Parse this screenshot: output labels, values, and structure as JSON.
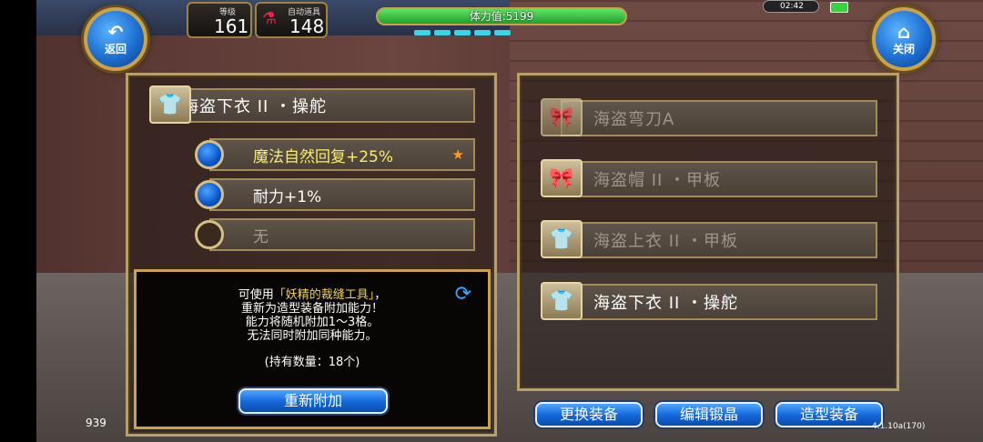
{
  "hud": {
    "back_label": "返回",
    "close_label": "关闭",
    "level_caption": "等级",
    "level_value": "161",
    "potion_caption": "自动道具",
    "potion_value": "148",
    "hp_text": "体力值:5199",
    "clock": "02:42",
    "partial_left_number": "939",
    "version": "4.1.10a(170)"
  },
  "left_panel": {
    "selected_item": "海盗下衣 II ・操舵",
    "abilities": [
      {
        "label": "魔法自然回复+25%",
        "highlight": true,
        "starred": true
      },
      {
        "label": "耐力+1%",
        "highlight": false,
        "starred": false
      },
      {
        "label": "无",
        "highlight": false,
        "starred": false
      }
    ],
    "info": {
      "line1_prefix": "可使用",
      "line1_item": "「妖精的裁缝工具」",
      "line1_suffix": "，",
      "line2": "重新为造型装备附加能力！",
      "line3": "能力将随机附加1～3格。",
      "line4": "无法同时附加同种能力。",
      "holdings": "(持有数量：18个)",
      "button": "重新附加"
    }
  },
  "right_panel": {
    "items": [
      {
        "name": "海盗弯刀A",
        "dim": true,
        "icon": "ribbon-icon"
      },
      {
        "name": "海盗帽 II ・甲板",
        "dim": true,
        "icon": "ribbon-icon"
      },
      {
        "name": "海盗上衣 II ・甲板",
        "dim": true,
        "icon": "armor-icon"
      },
      {
        "name": "海盗下衣 II ・操舵",
        "dim": false,
        "icon": "armor-icon"
      }
    ]
  },
  "bottom_buttons": {
    "swap": "更换装备",
    "edit": "编辑锻晶",
    "style": "造型装备"
  }
}
